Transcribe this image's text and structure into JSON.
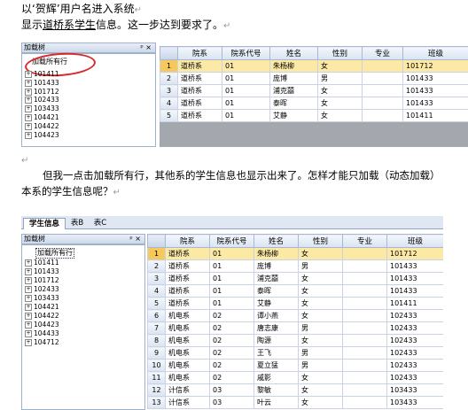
{
  "doc": {
    "line1": "以‘贺辉’用户名进入系统",
    "line2_prefix": "显示",
    "line2_underlined": "道桥系学生",
    "line2_suffix": "信息。这一步达到要求了。",
    "para1": "但我一点击加载所有行，其他系的学生信息也显示出来了。怎样才能只加载（动态加载）",
    "para2": "本系的学生信息呢？",
    "para_mark": "↵"
  },
  "shot1": {
    "pane_title": "加载树",
    "pin": "ᵖ ×",
    "root": "加载所有行",
    "nodes": [
      "101411",
      "101433",
      "101712",
      "102433",
      "103433",
      "104421",
      "104422",
      "104423"
    ],
    "columns": [
      "院系",
      "院系代号",
      "姓名",
      "性别",
      "专业",
      "班级"
    ],
    "rows": [
      [
        "1",
        "道桥系",
        "01",
        "朱杨柳",
        "女",
        "",
        "101712"
      ],
      [
        "2",
        "道桥系",
        "01",
        "庞博",
        "男",
        "",
        "101433"
      ],
      [
        "3",
        "道桥系",
        "01",
        "浦克囍",
        "女",
        "",
        "101433"
      ],
      [
        "4",
        "道桥系",
        "01",
        "泰晖",
        "女",
        "",
        "101433"
      ],
      [
        "5",
        "道桥系",
        "01",
        "艾静",
        "女",
        "",
        "101411"
      ]
    ]
  },
  "shot2": {
    "tabs": [
      "学生信息",
      "表B",
      "表C"
    ],
    "pane_title": "加载树",
    "pin": "ᵖ ×",
    "root": "加载所有行",
    "nodes": [
      "101411",
      "101433",
      "101712",
      "102433",
      "103433",
      "104421",
      "104422",
      "104423",
      "104433",
      "104712"
    ],
    "columns": [
      "院系",
      "院系代号",
      "姓名",
      "性别",
      "专业",
      "班级"
    ],
    "rows": [
      [
        "1",
        "道桥系",
        "01",
        "朱杨柳",
        "女",
        "",
        "101712"
      ],
      [
        "2",
        "道桥系",
        "01",
        "庞博",
        "男",
        "",
        "101433"
      ],
      [
        "3",
        "道桥系",
        "01",
        "浦克囍",
        "女",
        "",
        "101433"
      ],
      [
        "4",
        "道桥系",
        "01",
        "泰晖",
        "女",
        "",
        "101433"
      ],
      [
        "5",
        "道桥系",
        "01",
        "艾静",
        "女",
        "",
        "101411"
      ],
      [
        "6",
        "机电系",
        "02",
        "谭小燕",
        "女",
        "",
        "102433"
      ],
      [
        "7",
        "机电系",
        "02",
        "唐志康",
        "男",
        "",
        "102433"
      ],
      [
        "8",
        "机电系",
        "02",
        "陶源",
        "女",
        "",
        "102433"
      ],
      [
        "9",
        "机电系",
        "02",
        "王飞",
        "男",
        "",
        "102433"
      ],
      [
        "10",
        "机电系",
        "02",
        "夏立猛",
        "男",
        "",
        "102433"
      ],
      [
        "11",
        "机电系",
        "02",
        "戚影",
        "女",
        "",
        "102433"
      ],
      [
        "12",
        "计信系",
        "03",
        "黎敏",
        "女",
        "",
        "103433"
      ],
      [
        "13",
        "计信系",
        "03",
        "叶云",
        "女",
        "",
        "103433"
      ]
    ]
  }
}
